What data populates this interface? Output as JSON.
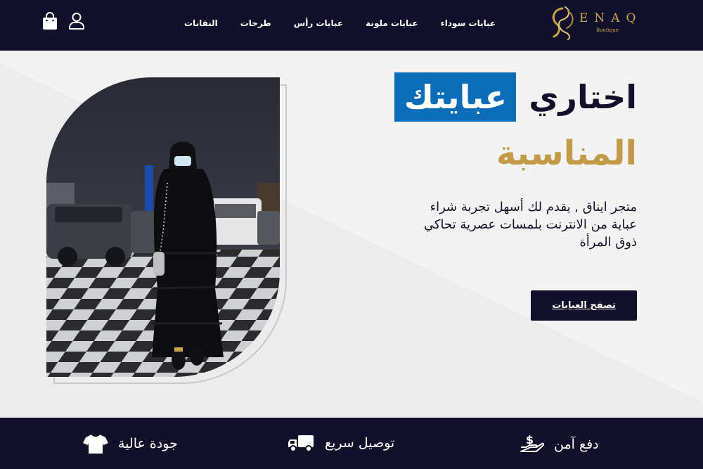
{
  "header": {
    "logo_text": "ENAQ",
    "logo_subtitle": "Boutique",
    "nav": [
      {
        "label": "عبايات سوداء"
      },
      {
        "label": "عبايات ملونة"
      },
      {
        "label": "عبايات رأس"
      },
      {
        "label": "طرحات"
      },
      {
        "label": "النقابات"
      }
    ],
    "icons": [
      "user-icon",
      "shopping-bag-icon"
    ]
  },
  "hero": {
    "headline_part1": "اختاري",
    "headline_highlight": "عبايتك",
    "headline_line2": "المناسبة",
    "description": "متجر ايناق , يقدم لك أسهل تجربة شراء عباية من الانترنت بلمسات عصرية تحاكي ذوق المرأة",
    "cta_label": "تصفح العبايات"
  },
  "features": [
    {
      "label": "دفع آمن",
      "icon": "hand-money-icon"
    },
    {
      "label": "توصيل سريع",
      "icon": "delivery-truck-icon"
    },
    {
      "label": "جودة عالية",
      "icon": "tshirt-icon"
    }
  ],
  "colors": {
    "navy": "#12102a",
    "gold": "#c39a48",
    "highlight_blue": "#0b6cb8",
    "background": "#f1f1f1"
  }
}
